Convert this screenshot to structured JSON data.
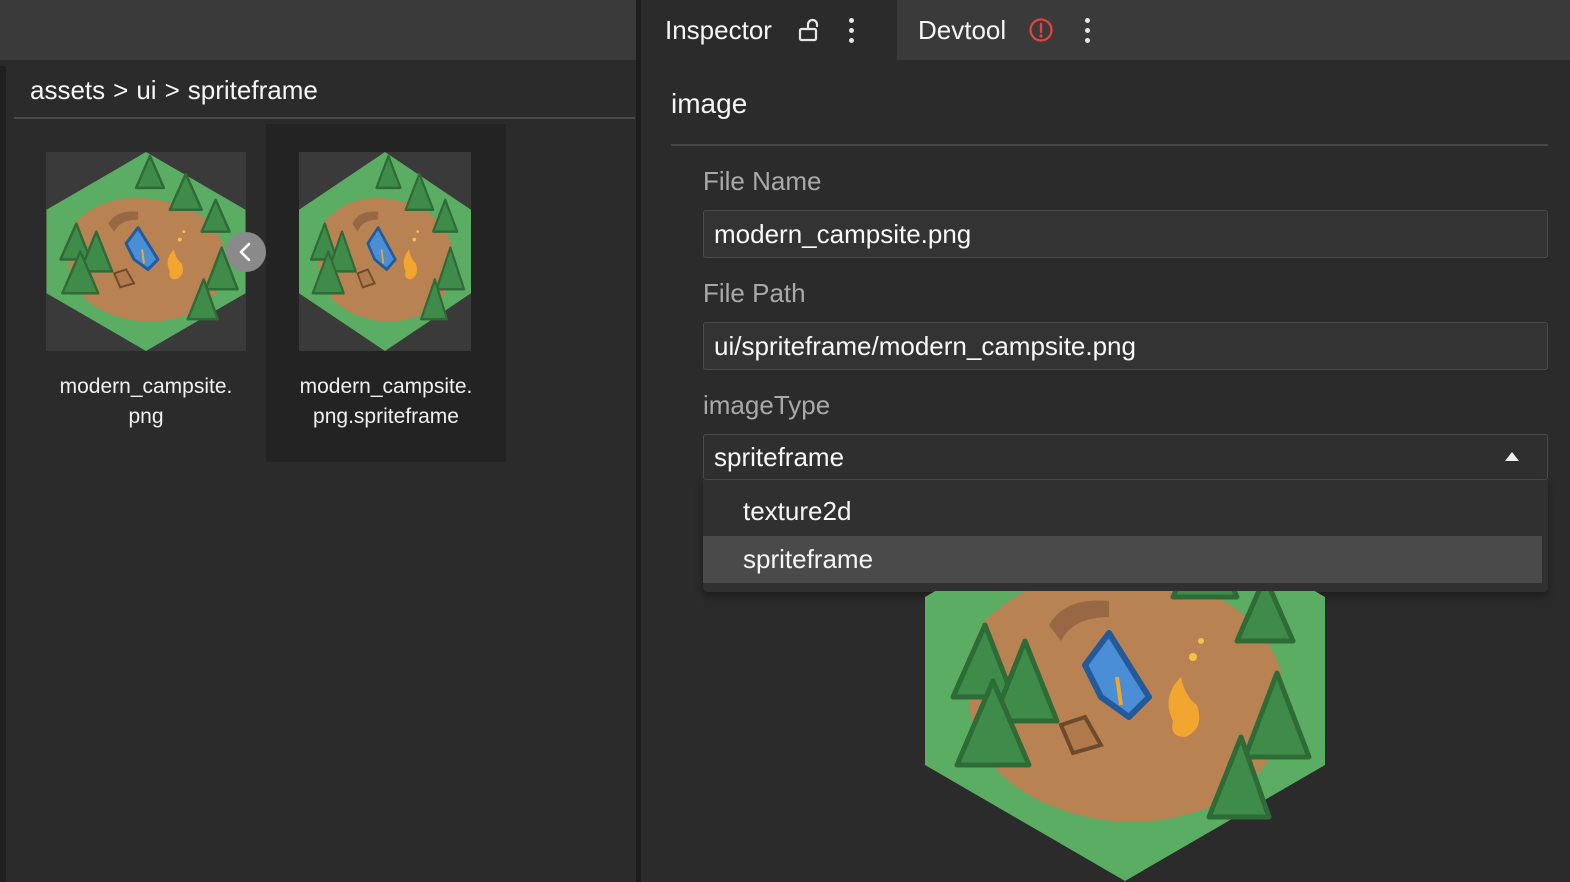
{
  "assets_panel": {
    "breadcrumb": [
      "assets",
      "ui",
      "spriteframe"
    ],
    "breadcrumb_separator": ">",
    "items": [
      {
        "line1": "modern_campsite.",
        "line2": "png",
        "icon": "png-image-thumbnail",
        "selected": false
      },
      {
        "line1": "modern_campsite.",
        "line2": "png.spriteframe",
        "icon": "spriteframe-thumbnail",
        "selected": true
      }
    ],
    "collapse_icon": "chevron-left-icon"
  },
  "tabs": [
    {
      "label": "Inspector",
      "icon": "lock-open-icon",
      "active": true
    },
    {
      "label": "Devtool",
      "icon": "warning-circle-icon",
      "active": false
    }
  ],
  "inspector": {
    "section_title": "image",
    "file_name_label": "File Name",
    "file_name_value": "modern_campsite.png",
    "file_path_label": "File Path",
    "file_path_value": "ui/spriteframe/modern_campsite.png",
    "image_type_label": "imageType",
    "image_type_value": "spriteframe",
    "image_type_options": [
      "texture2d",
      "spriteframe"
    ],
    "highlighted_option": "spriteframe"
  },
  "colors": {
    "panel_bg": "#2b2b2b",
    "topbar_bg": "#3a3a3a",
    "label_gray": "#a9a9a9",
    "warning_red": "#e0453d",
    "grass_green": "#5aad62",
    "dirt_brown": "#b88252",
    "tent_blue": "#4a8fd6",
    "fire_orange": "#f2a52f"
  }
}
